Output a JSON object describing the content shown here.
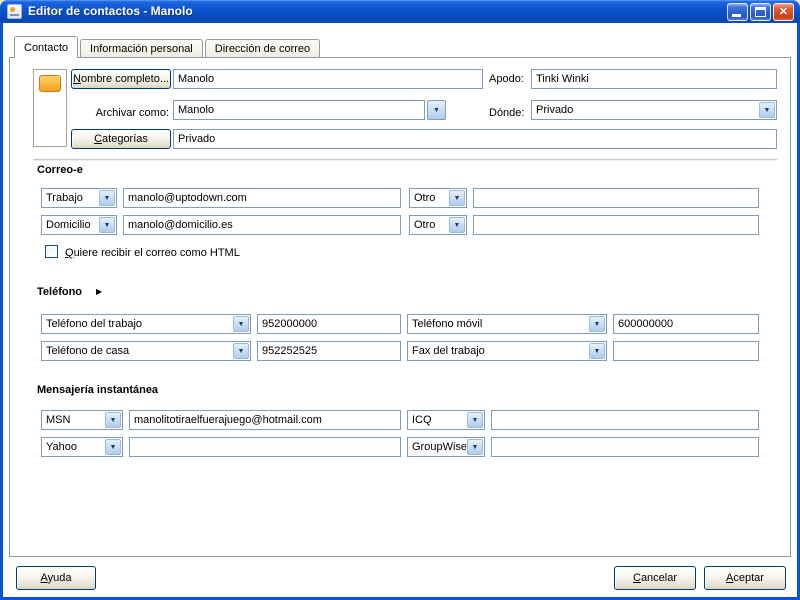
{
  "window": {
    "title": "Editor de contactos - Manolo"
  },
  "icons": {
    "close": "✕",
    "dropdown": "▼",
    "expander": "▶"
  },
  "tabs": [
    {
      "label": "Contacto"
    },
    {
      "label": "Información personal"
    },
    {
      "label": "Dirección de correo"
    }
  ],
  "header": {
    "full_name_button": "Nombre completo...",
    "full_name_value": "Manolo",
    "nickname_label": "Apodo:",
    "nickname_value": "Tinki Winki",
    "file_as_label": "Archivar como:",
    "file_as_value": "Manolo",
    "where_label": "Dónde:",
    "where_value": "Privado",
    "categories_button": "Categorías",
    "categories_value": "Privado"
  },
  "email_section": {
    "title": "Correo-e",
    "rows": [
      {
        "type_left": "Trabajo",
        "value_left": "manolo@uptodown.com",
        "type_right": "Otro",
        "value_right": ""
      },
      {
        "type_left": "Domicilio",
        "value_left": "manolo@domicilio.es",
        "type_right": "Otro",
        "value_right": ""
      }
    ],
    "html_checkbox_label": "Quiere recibir el correo como HTML",
    "html_checkbox_checked": false
  },
  "phone_section": {
    "title": "Teléfono",
    "rows": [
      {
        "type_left": "Teléfono del trabajo",
        "value_left": "952000000",
        "type_right": "Teléfono móvil",
        "value_right": "600000000"
      },
      {
        "type_left": "Teléfono de casa",
        "value_left": "952252525",
        "type_right": "Fax del trabajo",
        "value_right": ""
      }
    ]
  },
  "im_section": {
    "title": "Mensajería instantánea",
    "rows": [
      {
        "type_left": "MSN",
        "value_left": "manolitotiraelfuerajuego@hotmail.com",
        "type_right": "ICQ",
        "value_right": ""
      },
      {
        "type_left": "Yahoo",
        "value_left": "",
        "type_right": "GroupWise",
        "value_right": ""
      }
    ]
  },
  "footer": {
    "help_label": "Ayuda",
    "cancel_label": "Cancelar",
    "accept_label": "Aceptar"
  }
}
